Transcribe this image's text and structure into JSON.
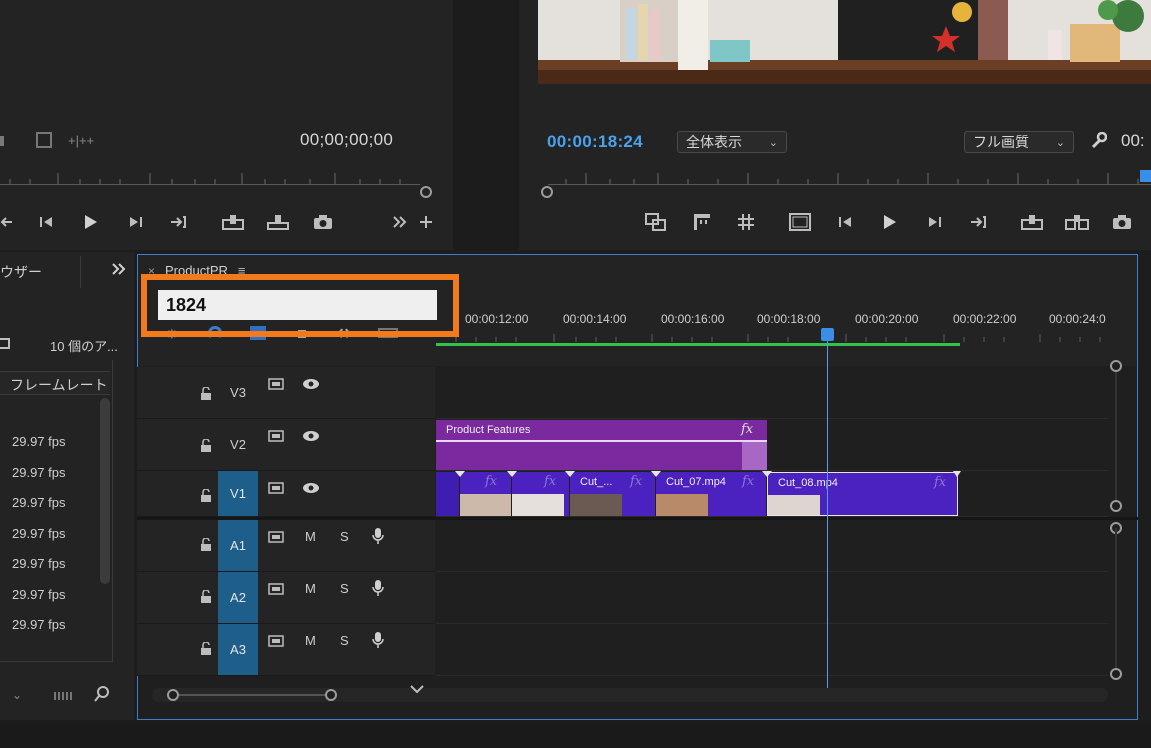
{
  "source_monitor": {
    "timecode": "00;00;00;00"
  },
  "program_monitor": {
    "timecode": "00:00:18:24",
    "zoom_dropdown": "全体表示",
    "quality_dropdown": "フル画質",
    "timecode_right_partial": "00:"
  },
  "project_panel": {
    "title": "ウザー",
    "item_count": "10 個のア...",
    "frame_rate_header": "フレームレート",
    "fps_values": [
      "29.97 fps",
      "29.97 fps",
      "29.97 fps",
      "29.97 fps",
      "29.97 fps",
      "29.97 fps",
      "29.97 fps"
    ]
  },
  "timeline": {
    "sequence_name": "ProductPR",
    "timecode_input_value": "1824",
    "time_labels": [
      "00:00:12:00",
      "00:00:14:00",
      "00:00:16:00",
      "00:00:18:00",
      "00:00:20:00",
      "00:00:22:00",
      "00:00:24:0"
    ],
    "tracks": {
      "v3": "V3",
      "v2": "V2",
      "v1": "V1",
      "a1": "A1",
      "a2": "A2",
      "a3": "A3"
    },
    "mute_label": "M",
    "solo_label": "S",
    "clips": {
      "product_features": "Product Features",
      "cut_short": "Cut_...",
      "cut_07": "Cut_07.mp4",
      "cut_08": "Cut_08.mp4"
    },
    "fx_label": "fx"
  },
  "colors": {
    "accent_blue": "#4aa2ef",
    "highlight_orange": "#f17a1d",
    "clip_purple": "#7a2a9e",
    "clip_violet": "#4b22c0",
    "track_active": "#1d5f8a",
    "workarea_green": "#33c24a"
  }
}
